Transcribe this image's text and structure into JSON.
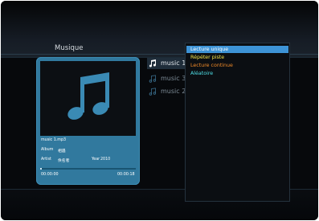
{
  "screen": {
    "title": "Musique"
  },
  "now_playing": {
    "filename": "music 1.mp3",
    "album_label": "Album",
    "album_value": "相遇",
    "artist_label": "Artist",
    "artist_value": "佚名者",
    "year_label": "Year",
    "year_value": "2010",
    "time_elapsed": "00:00:00",
    "time_total": "00:00:18",
    "progress_fraction": 0.02
  },
  "file_list": {
    "items": [
      {
        "label": "music 1"
      },
      {
        "label": "music 3"
      },
      {
        "label": "music 2"
      }
    ]
  },
  "play_mode_menu": {
    "items": [
      {
        "label": "Lecture unique",
        "color": "#ffffff"
      },
      {
        "label": "Répéter piste",
        "color": "#f2e24a"
      },
      {
        "label": "Lecture continue",
        "color": "#f08a28"
      },
      {
        "label": "Aléatoire",
        "color": "#4fe0e8"
      }
    ],
    "selected_index": 0
  },
  "colors": {
    "accent": "#3d93d6",
    "card": "#31799e",
    "note_icon": "#3a8ab4"
  },
  "icons": {
    "cover": "music-note-icon",
    "list": "music-note-icon"
  }
}
